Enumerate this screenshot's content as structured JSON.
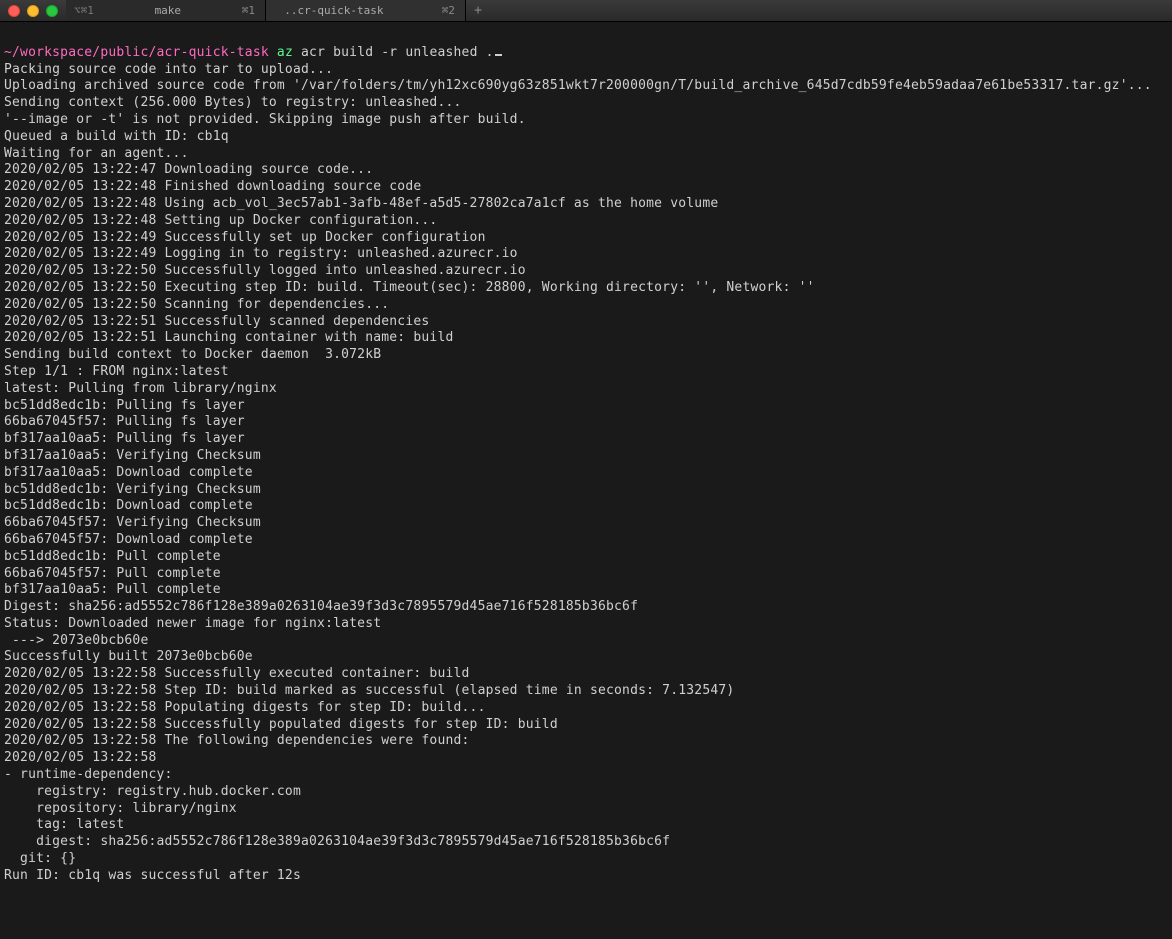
{
  "titlebar": {
    "tabs": [
      {
        "label": "make",
        "hint": "⌘1",
        "prefix": "⌥⌘1"
      },
      {
        "label": "..cr-quick-task",
        "hint": "⌘2",
        "prefix": ""
      }
    ],
    "add": "+"
  },
  "prompt": {
    "path": "~/workspace/public/acr-quick-task",
    "cmd": "az",
    "args": "acr build -r unleashed ."
  },
  "output": [
    "Packing source code into tar to upload...",
    "Uploading archived source code from '/var/folders/tm/yh12xc690yg63z851wkt7r200000gn/T/build_archive_645d7cdb59fe4eb59adaa7e61be53317.tar.gz'...",
    "Sending context (256.000 Bytes) to registry: unleashed...",
    "'--image or -t' is not provided. Skipping image push after build.",
    "Queued a build with ID: cb1q",
    "Waiting for an agent...",
    "2020/02/05 13:22:47 Downloading source code...",
    "2020/02/05 13:22:48 Finished downloading source code",
    "2020/02/05 13:22:48 Using acb_vol_3ec57ab1-3afb-48ef-a5d5-27802ca7a1cf as the home volume",
    "2020/02/05 13:22:48 Setting up Docker configuration...",
    "2020/02/05 13:22:49 Successfully set up Docker configuration",
    "2020/02/05 13:22:49 Logging in to registry: unleashed.azurecr.io",
    "2020/02/05 13:22:50 Successfully logged into unleashed.azurecr.io",
    "2020/02/05 13:22:50 Executing step ID: build. Timeout(sec): 28800, Working directory: '', Network: ''",
    "2020/02/05 13:22:50 Scanning for dependencies...",
    "2020/02/05 13:22:51 Successfully scanned dependencies",
    "2020/02/05 13:22:51 Launching container with name: build",
    "Sending build context to Docker daemon  3.072kB",
    "Step 1/1 : FROM nginx:latest",
    "latest: Pulling from library/nginx",
    "bc51dd8edc1b: Pulling fs layer",
    "66ba67045f57: Pulling fs layer",
    "bf317aa10aa5: Pulling fs layer",
    "bf317aa10aa5: Verifying Checksum",
    "bf317aa10aa5: Download complete",
    "bc51dd8edc1b: Verifying Checksum",
    "bc51dd8edc1b: Download complete",
    "66ba67045f57: Verifying Checksum",
    "66ba67045f57: Download complete",
    "bc51dd8edc1b: Pull complete",
    "66ba67045f57: Pull complete",
    "bf317aa10aa5: Pull complete",
    "Digest: sha256:ad5552c786f128e389a0263104ae39f3d3c7895579d45ae716f528185b36bc6f",
    "Status: Downloaded newer image for nginx:latest",
    " ---> 2073e0bcb60e",
    "Successfully built 2073e0bcb60e",
    "2020/02/05 13:22:58 Successfully executed container: build",
    "2020/02/05 13:22:58 Step ID: build marked as successful (elapsed time in seconds: 7.132547)",
    "2020/02/05 13:22:58 Populating digests for step ID: build...",
    "2020/02/05 13:22:58 Successfully populated digests for step ID: build",
    "2020/02/05 13:22:58 The following dependencies were found:",
    "2020/02/05 13:22:58",
    "- runtime-dependency:",
    "    registry: registry.hub.docker.com",
    "    repository: library/nginx",
    "    tag: latest",
    "    digest: sha256:ad5552c786f128e389a0263104ae39f3d3c7895579d45ae716f528185b36bc6f",
    "  git: {}",
    "",
    "",
    "Run ID: cb1q was successful after 12s"
  ]
}
